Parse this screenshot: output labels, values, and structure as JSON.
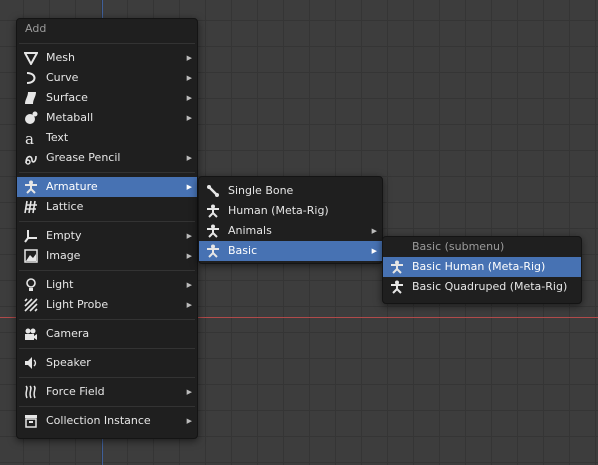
{
  "main_menu": {
    "title": "Add",
    "items": [
      {
        "label": "Mesh",
        "icon": "mesh-icon",
        "submenu": true
      },
      {
        "label": "Curve",
        "icon": "curve-icon",
        "submenu": true
      },
      {
        "label": "Surface",
        "icon": "surface-icon",
        "submenu": true
      },
      {
        "label": "Metaball",
        "icon": "metaball-icon",
        "submenu": true
      },
      {
        "label": "Text",
        "icon": "text-icon",
        "submenu": false
      },
      {
        "label": "Grease Pencil",
        "icon": "grease-pencil-icon",
        "submenu": true
      },
      {
        "label": "Armature",
        "icon": "armature-icon",
        "submenu": true,
        "active": true
      },
      {
        "label": "Lattice",
        "icon": "lattice-icon",
        "submenu": false
      },
      {
        "label": "Empty",
        "icon": "empty-icon",
        "submenu": true
      },
      {
        "label": "Image",
        "icon": "image-icon",
        "submenu": true
      },
      {
        "label": "Light",
        "icon": "light-icon",
        "submenu": true
      },
      {
        "label": "Light Probe",
        "icon": "light-probe-icon",
        "submenu": true
      },
      {
        "label": "Camera",
        "icon": "camera-icon",
        "submenu": false
      },
      {
        "label": "Speaker",
        "icon": "speaker-icon",
        "submenu": false
      },
      {
        "label": "Force Field",
        "icon": "force-field-icon",
        "submenu": true
      },
      {
        "label": "Collection Instance",
        "icon": "collection-icon",
        "submenu": true
      }
    ]
  },
  "armature_menu": {
    "items": [
      {
        "label": "Single Bone",
        "icon": "bone-icon",
        "submenu": false
      },
      {
        "label": "Human (Meta-Rig)",
        "icon": "armature-icon",
        "submenu": false
      },
      {
        "label": "Animals",
        "icon": "armature-icon",
        "submenu": true
      },
      {
        "label": "Basic",
        "icon": "armature-icon",
        "submenu": true,
        "active": true
      }
    ]
  },
  "basic_menu": {
    "title": "Basic (submenu)",
    "items": [
      {
        "label": "Basic Human (Meta-Rig)",
        "icon": "armature-icon",
        "active": true
      },
      {
        "label": "Basic Quadruped (Meta-Rig)",
        "icon": "armature-icon",
        "active": false
      }
    ]
  },
  "colors": {
    "highlight": "#4772b3",
    "menu_bg": "#1f1f1f",
    "viewport_bg": "#3d3d3d"
  }
}
